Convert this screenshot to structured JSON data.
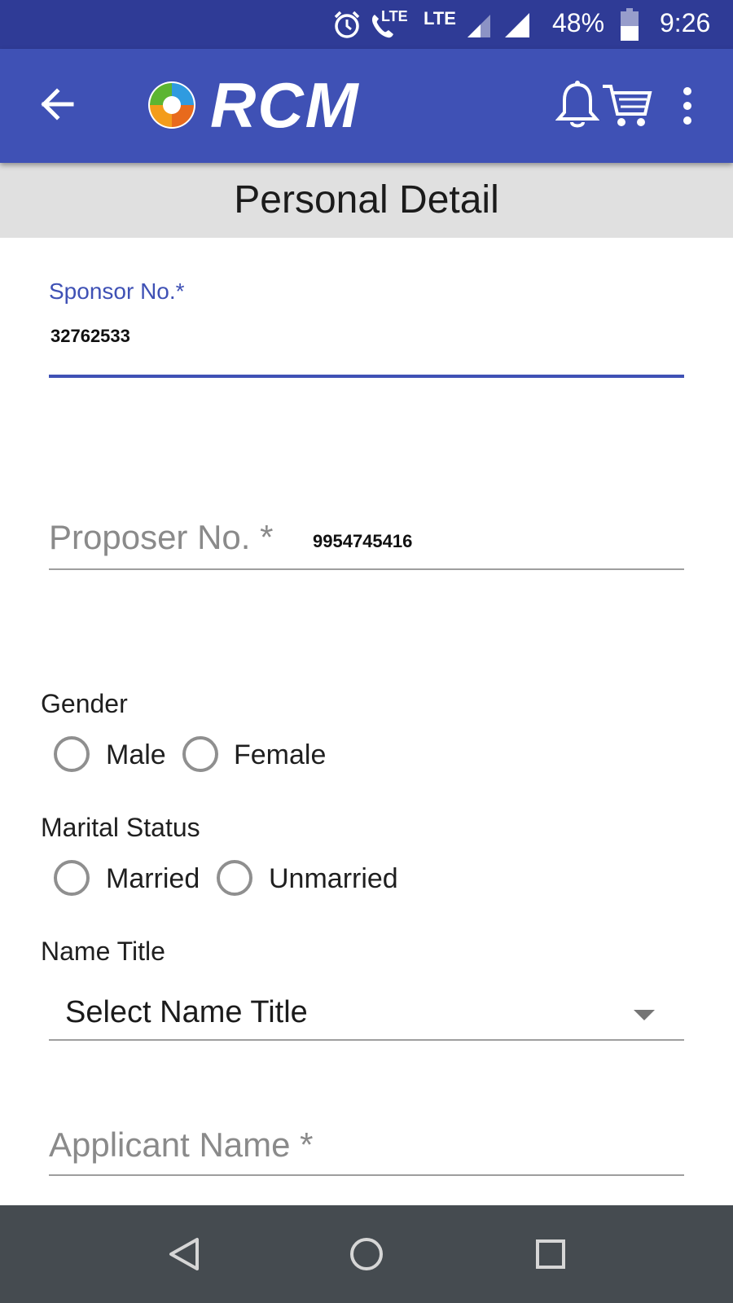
{
  "status_bar": {
    "network_labels": [
      "LTE",
      "LTE"
    ],
    "battery": "48%",
    "time": "9:26",
    "icons": [
      "alarm-icon",
      "volte-call-icon",
      "signal-icon",
      "signal-icon",
      "battery-icon"
    ]
  },
  "app_bar": {
    "logo_text": "RCM",
    "icons": [
      "back-arrow-icon",
      "bell-icon",
      "cart-icon",
      "overflow-menu-icon"
    ]
  },
  "page": {
    "title": "Personal Detail"
  },
  "form": {
    "sponsor": {
      "label": "Sponsor No.*",
      "value": "32762533"
    },
    "proposer": {
      "placeholder": "Proposer No. *",
      "value": "9954745416"
    },
    "gender": {
      "label": "Gender",
      "options": [
        "Male",
        "Female"
      ]
    },
    "marital_status": {
      "label": "Marital Status",
      "options": [
        "Married",
        "Unmarried"
      ]
    },
    "name_title": {
      "label": "Name Title",
      "selected": "Select Name Title"
    },
    "applicant_name": {
      "placeholder": "Applicant Name *"
    }
  },
  "nav_bar": {
    "icons": [
      "back-triangle-icon",
      "home-circle-icon",
      "recents-square-icon"
    ]
  },
  "colors": {
    "primary": "#3f51b5",
    "primary_dark": "#2f3b96",
    "nav_bar": "#454b50",
    "title_band": "#e0e0e0"
  }
}
